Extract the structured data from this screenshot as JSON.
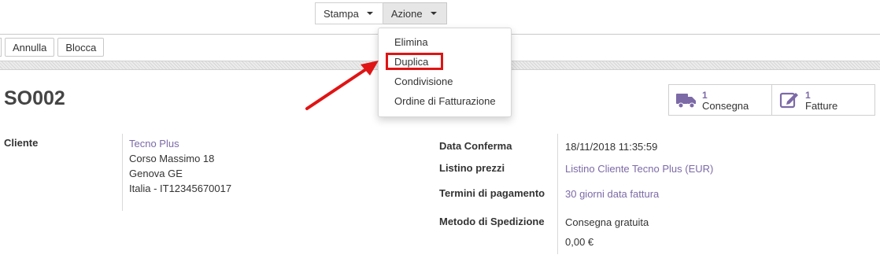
{
  "toolbar": {
    "print_label": "Stampa",
    "action_label": "Azione"
  },
  "action_menu": {
    "items": [
      {
        "label": "Elimina"
      },
      {
        "label": "Duplica"
      },
      {
        "label": "Condivisione"
      },
      {
        "label": "Ordine di Fatturazione"
      }
    ]
  },
  "status_buttons": {
    "cancel": "Annulla",
    "lock": "Blocca"
  },
  "record": {
    "name": "SO002"
  },
  "smart_buttons": [
    {
      "count": "1",
      "label": "Consegna",
      "icon": "truck-icon"
    },
    {
      "count": "1",
      "label": "Fatture",
      "icon": "edit-icon"
    }
  ],
  "customer": {
    "label": "Cliente",
    "name": "Tecno Plus",
    "street": "Corso Massimo 18",
    "city": "Genova GE",
    "country_vat": "Italia - IT12345670017"
  },
  "details": {
    "confirm_label": "Data Conferma",
    "confirm_value": "18/11/2018 11:35:59",
    "pricelist_label": "Listino prezzi",
    "pricelist_value": "Listino Cliente Tecno Plus (EUR)",
    "payment_label": "Termini di pagamento",
    "payment_value": "30 giorni data fattura",
    "shipping_label": "Metodo di Spedizione",
    "shipping_value": "Consegna gratuita",
    "shipping_amount": "0,00 €"
  },
  "colors": {
    "link": "#7c6aa7",
    "annotation": "#e01414"
  }
}
